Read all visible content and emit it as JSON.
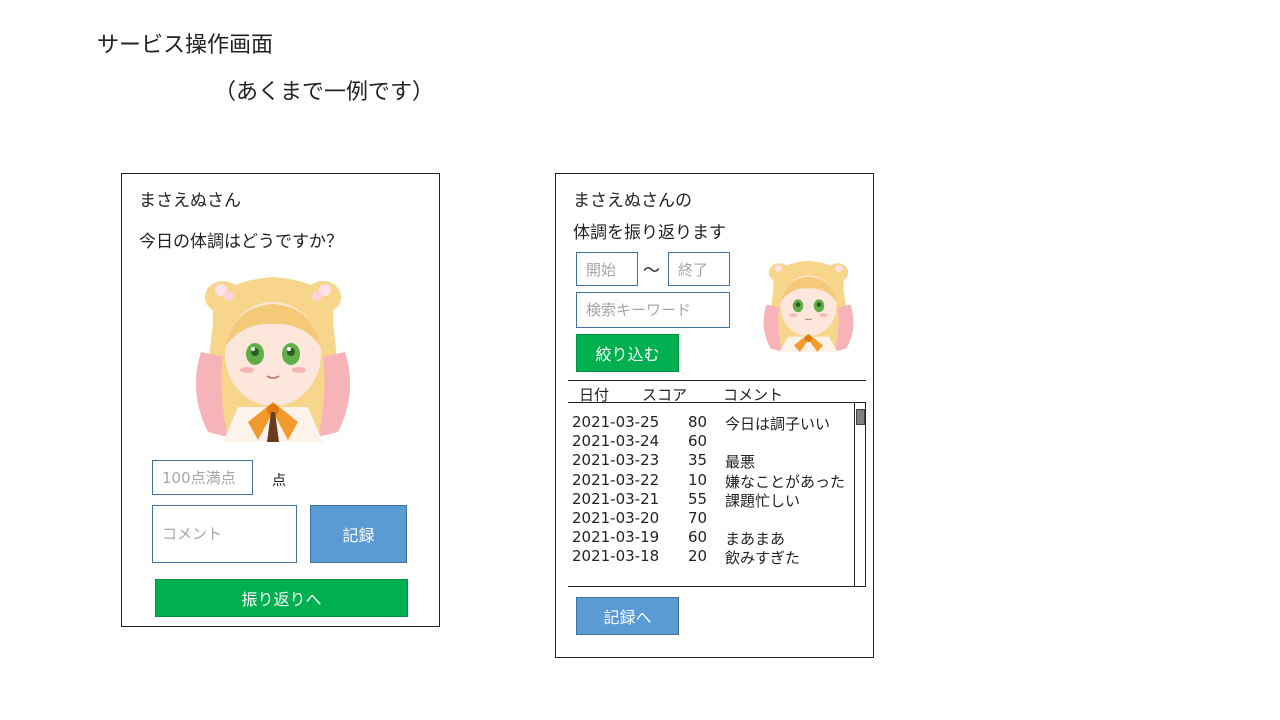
{
  "header": {
    "title": "サービス操作画面",
    "subtitle": "（あくまで一例です）"
  },
  "record_screen": {
    "user_name": "まさえぬさん",
    "question": "今日の体調はどうですか？",
    "score_placeholder": "100点満点",
    "score_unit": "点",
    "comment_placeholder": "コメント",
    "record_button": "記録",
    "review_button": "振り返りへ"
  },
  "review_screen": {
    "heading_line1": "まさえぬさんの",
    "heading_line2": "体調を振り返ります",
    "start_placeholder": "開始",
    "range_separator": "～",
    "end_placeholder": "終了",
    "keyword_placeholder": "検索キーワード",
    "filter_button": "絞り込む",
    "table": {
      "columns": [
        "日付",
        "スコア",
        "コメント"
      ],
      "rows": [
        {
          "date": "2021-03-25",
          "score": "80",
          "comment": "今日は調子いい"
        },
        {
          "date": "2021-03-24",
          "score": "60",
          "comment": ""
        },
        {
          "date": "2021-03-23",
          "score": "35",
          "comment": "最悪"
        },
        {
          "date": "2021-03-22",
          "score": "10",
          "comment": "嫌なことがあった"
        },
        {
          "date": "2021-03-21",
          "score": "55",
          "comment": "課題忙しい"
        },
        {
          "date": "2021-03-20",
          "score": "70",
          "comment": ""
        },
        {
          "date": "2021-03-19",
          "score": "60",
          "comment": "まあまあ"
        },
        {
          "date": "2021-03-18",
          "score": "20",
          "comment": "飲みすぎた"
        }
      ]
    },
    "record_button": "記録へ"
  },
  "colors": {
    "green_button": "#00b050",
    "blue_button": "#5b9bd5",
    "input_border": "#41719c"
  },
  "icons": {
    "avatar": "anime-girl-avatar"
  }
}
